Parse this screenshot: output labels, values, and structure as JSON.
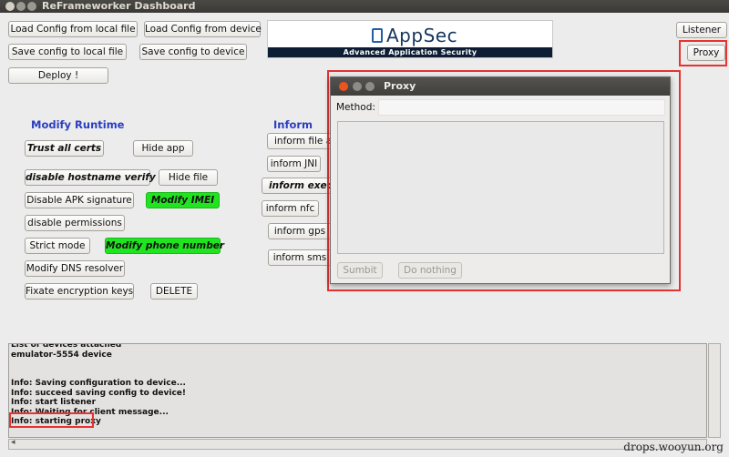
{
  "window": {
    "title": "ReFrameworker Dashboard"
  },
  "config_buttons": {
    "load_local": "Load Config from local file",
    "load_device": "Load Config from device",
    "save_local": "Save config to local file",
    "save_device": "Save config to device",
    "deploy": "Deploy !"
  },
  "logo": {
    "brand": "AppSec",
    "tagline": "Advanced Application Security"
  },
  "top_right": {
    "listener": "Listener",
    "proxy": "Proxy"
  },
  "runtime": {
    "heading": "Modify Runtime",
    "trust_all_certs": "Trust all certs",
    "hide_app": "Hide app",
    "disable_hostname_verify": "disable hostname verify",
    "hide_file": "Hide file",
    "disable_apk_signature": "Disable APK signature",
    "modify_imei": "Modify IMEI",
    "disable_permissions": "disable permissions",
    "strict_mode": "Strict mode",
    "modify_phone_number": "Modify phone number",
    "modify_dns_resolver": "Modify DNS resolver",
    "fixate_encryption_keys": "Fixate encryption keys",
    "delete": "DELETE"
  },
  "inform": {
    "heading": "Inform",
    "file_access": "inform file acc",
    "jni": "inform JNI",
    "exec": "inform exec p",
    "nfc": "inform nfc",
    "gps": "inform gps",
    "sms": "inform sms"
  },
  "proxy_dialog": {
    "title": "Proxy",
    "method_label": "Method:",
    "method_value": "",
    "submit": "Sumbit",
    "do_nothing": "Do nothing"
  },
  "log": {
    "lines": [
      "List of devices attached",
      "emulator-5554   device",
      "",
      "",
      "Info: Saving configuration to device...",
      "Info: succeed saving config to device!",
      "Info: start listener",
      "Info: Waiting for client message...",
      "Info: starting proxy"
    ]
  },
  "watermark": "drops.wooyun.org",
  "colors": {
    "highlight_red": "#e53333",
    "green_toggle": "#21e421",
    "section_blue": "#2a3ec0"
  }
}
